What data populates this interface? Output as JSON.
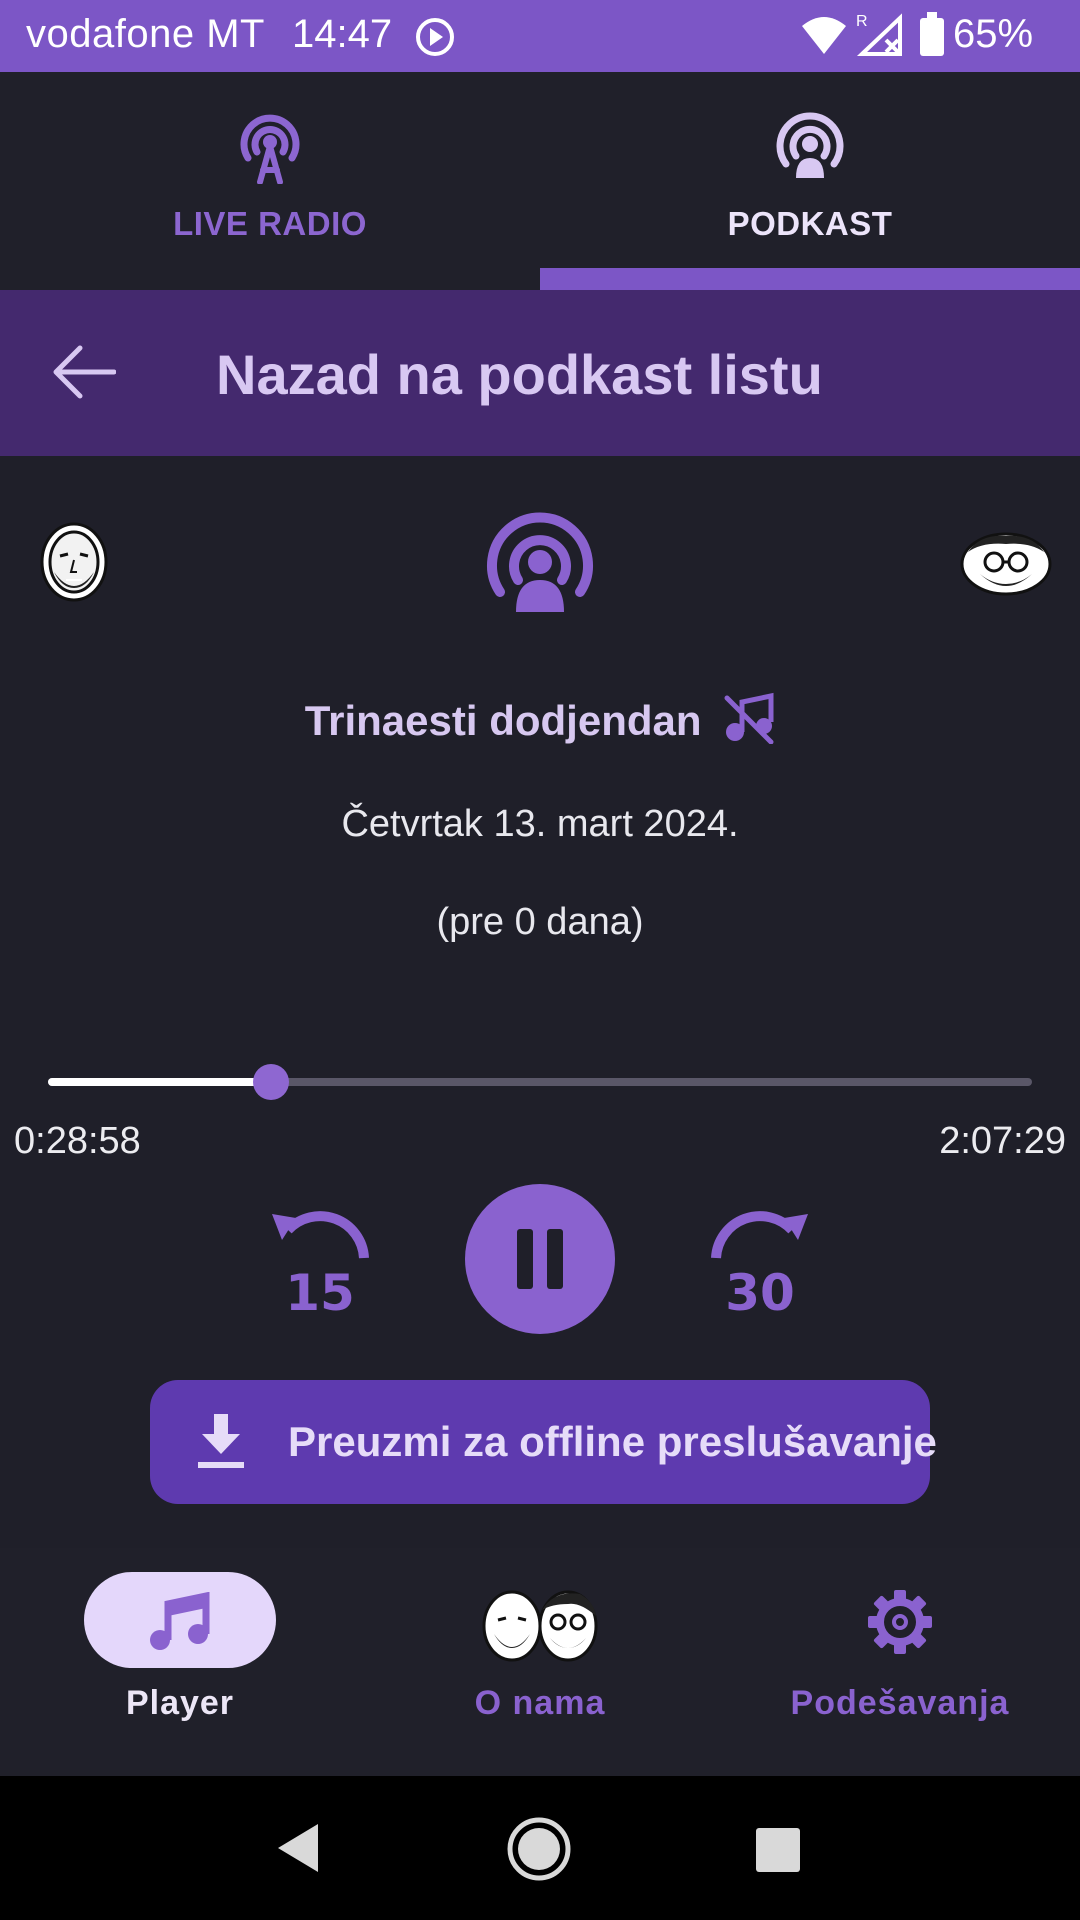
{
  "status_bar": {
    "carrier": "vodafone MT",
    "time": "14:47",
    "battery_percent": "65%",
    "icons": [
      "play-circle-icon",
      "wifi-icon",
      "signal-roaming-icon",
      "battery-icon"
    ]
  },
  "tabs": [
    {
      "label": "LIVE RADIO",
      "icon": "radio-tower-icon",
      "selected": false
    },
    {
      "label": "PODKAST",
      "icon": "podcast-icon",
      "selected": true
    }
  ],
  "back_header": {
    "icon": "arrow-left-icon",
    "title": "Nazad na podkast listu"
  },
  "episode": {
    "title": "Trinaesti dodjendan",
    "title_icon": "music-off-icon",
    "date": "Četvrtak 13. mart 2024.",
    "ago": "(pre 0 dana)"
  },
  "player": {
    "current_time": "0:28:58",
    "total_time": "2:07:29",
    "progress_fraction": 0.227,
    "rewind_label": "15",
    "forward_label": "30",
    "rewind_icon": "replay-15-icon",
    "play_pause_icon": "pause-icon",
    "forward_icon": "forward-30-icon"
  },
  "download_button": {
    "icon": "download-icon",
    "label": "Preuzmi za offline preslušavanje"
  },
  "bottom_nav": [
    {
      "label": "Player",
      "icon": "music-note-icon",
      "selected": true
    },
    {
      "label": "O nama",
      "icon": "hosts-avatars-icon",
      "selected": false
    },
    {
      "label": "Podešavanja",
      "icon": "gear-icon",
      "selected": false
    }
  ],
  "colors": {
    "accent": "#7c56c6",
    "accent_light": "#d8c8f2",
    "background": "#1f1f29",
    "header": "#44296e",
    "button": "#5e3aaf"
  }
}
